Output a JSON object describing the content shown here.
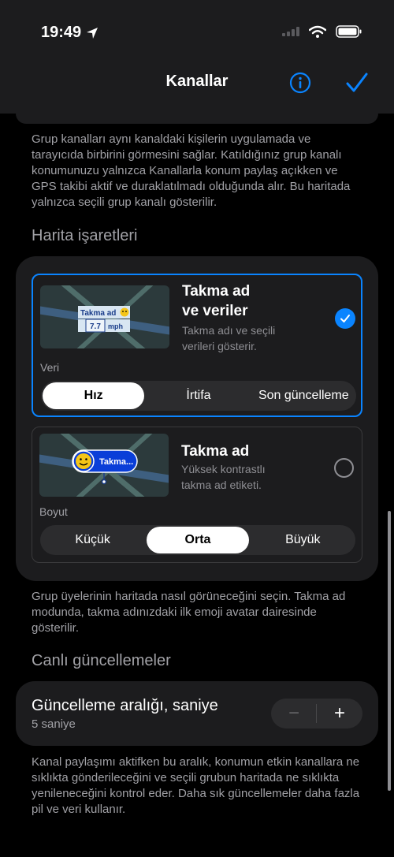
{
  "status": {
    "time": "19:49"
  },
  "nav": {
    "title": "Kanallar"
  },
  "channels_footer": "Grup kanalları aynı kanaldaki kişilerin uygulamada ve tarayıcıda birbirini görmesini sağlar. Katıldığınız grup kanalı konumunuzu yalnızca Kanallarla konum paylaş açıkken ve GPS takibi aktif ve duraklatılmadı olduğunda alır. Bu haritada yalnızca seçili grup kanalı gösterilir.",
  "map_markers": {
    "header": "Harita işaretleri",
    "option1": {
      "title_line1": "Takma ad",
      "title_line2": "ve veriler",
      "desc_line1": "Takma adı ve seçili",
      "desc_line2": "verileri gösterir.",
      "thumb_name": "Takma ad",
      "thumb_speed": "7.7",
      "thumb_unit": "mph",
      "data_label": "Veri",
      "segments": [
        "Hız",
        "İrtifa",
        "Son güncelleme"
      ],
      "selected_segment": "Hız",
      "selected": true
    },
    "option2": {
      "title": "Takma ad",
      "desc_line1": "Yüksek kontrastlı",
      "desc_line2": "takma ad etiketi.",
      "thumb_name": "Takma...",
      "size_label": "Boyut",
      "segments": [
        "Küçük",
        "Orta",
        "Büyük"
      ],
      "selected_segment": "Orta",
      "selected": false
    },
    "footer": "Grup üyelerinin haritada nasıl görüneceğini seçin. Takma ad modunda, takma adınızdaki ilk emoji avatar dairesinde gösterilir."
  },
  "live_updates": {
    "header": "Canlı güncellemeler",
    "interval_title": "Güncelleme aralığı, saniye",
    "interval_value": "5 saniye",
    "minus": "−",
    "plus": "+",
    "footer": "Kanal paylaşımı aktifken bu aralık, konumun etkin kanallara ne sıklıkta gönderileceğini ve seçili grubun haritada ne sıklıkta yenileneceğini kontrol eder. Daha sık güncellemeler daha fazla pil ve veri kullanır."
  },
  "colors": {
    "accent": "#0a84ff",
    "background": "#000000",
    "card": "#1c1c1e",
    "secondary_text": "#a1a1a6"
  }
}
